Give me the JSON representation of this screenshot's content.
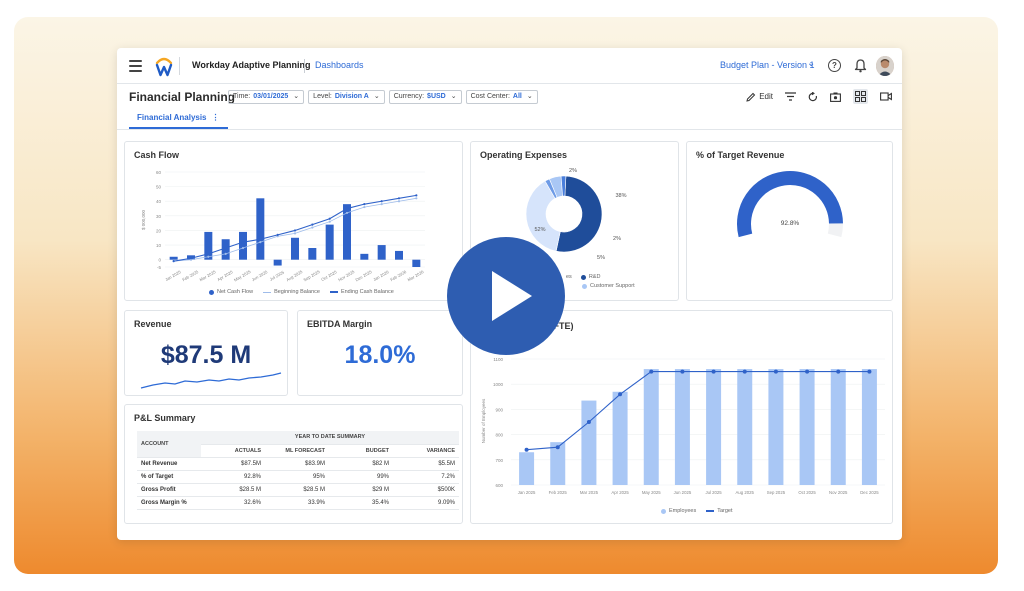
{
  "header": {
    "app_title": "Workday Adaptive Planning",
    "breadcrumb": "Dashboards",
    "plan_selector": "Budget Plan - Version 1",
    "help": "?"
  },
  "subheader": {
    "page_title": "Financial Planning",
    "filters": [
      {
        "label": "Time:",
        "value": "03/01/2025"
      },
      {
        "label": "Level:",
        "value": "Division A"
      },
      {
        "label": "Currency:",
        "value": "$USD"
      },
      {
        "label": "Cost Center:",
        "value": "All"
      }
    ],
    "edit_label": "Edit",
    "tab": "Financial Analysis"
  },
  "cards": {
    "cash_flow": {
      "title": "Cash Flow"
    },
    "operating_expenses": {
      "title": "Operating Expenses"
    },
    "target_revenue": {
      "title": "% of Target Revenue"
    },
    "revenue": {
      "title": "Revenue",
      "value": "$87.5 M"
    },
    "ebitda": {
      "title": "EBITDA Margin",
      "value": "18.0%"
    },
    "pl_summary": {
      "title": "P&L Summary"
    },
    "fte": {
      "title_fragment": "s (FTE)"
    }
  },
  "pl_table": {
    "account_header": "ACCOUNT",
    "group_header": "YEAR TO DATE SUMMARY",
    "columns": [
      "ACTUALS",
      "ML FORECAST",
      "BUDGET",
      "VARIANCE"
    ],
    "rows": [
      {
        "account": "Net Revenue",
        "values": [
          "$87.5M",
          "$83.9M",
          "$82 M",
          "$5.5M"
        ]
      },
      {
        "account": "% of Target",
        "values": [
          "92.8%",
          "95%",
          "99%",
          "7.2%"
        ]
      },
      {
        "account": "Gross Profit",
        "values": [
          "$28.5 M",
          "$28.5 M",
          "$29 M",
          "$500K"
        ]
      },
      {
        "account": "Gross Margin %",
        "values": [
          "32.6%",
          "33.9%",
          "35.4%",
          "9.09%"
        ]
      }
    ]
  },
  "colors": {
    "accent": "#2e6bd6",
    "bar_dark": "#2f62c9",
    "bar_light": "#a9c7f5",
    "play": "#2e5db1"
  },
  "chart_data": [
    {
      "type": "bar",
      "title": "Cash Flow",
      "ylabel": "$ 000,000",
      "categories": [
        "Jan 2025",
        "Feb 2025",
        "Mar 2025",
        "Apr 2025",
        "May 2025",
        "Jun 2025",
        "Jul 2025",
        "Aug 2025",
        "Sep 2025",
        "Oct 2025",
        "Nov 2025",
        "Dec 2025",
        "Jan 2026",
        "Feb 2026",
        "Mar 2026"
      ],
      "ylim": [
        -5,
        60
      ],
      "yticks": [
        -5,
        0,
        10,
        20,
        30,
        40,
        50,
        60
      ],
      "series": [
        {
          "name": "Net Cash Flow",
          "type": "bar",
          "values": [
            2,
            3,
            19,
            14,
            19,
            42,
            -4,
            15,
            8,
            24,
            38,
            4,
            10,
            6,
            -5
          ]
        },
        {
          "name": "Beginning Balance",
          "type": "line",
          "values": [
            -1,
            0,
            2,
            4,
            8,
            12,
            16,
            18,
            22,
            26,
            32,
            36,
            38,
            40,
            42
          ]
        },
        {
          "name": "Ending Cash Balance",
          "type": "line",
          "values": [
            -1,
            1,
            4,
            8,
            12,
            14,
            17,
            20,
            24,
            28,
            35,
            38,
            40,
            42,
            44
          ]
        }
      ]
    },
    {
      "type": "pie",
      "title": "Operating Expenses",
      "series": [
        {
          "name": "Operating Expenses",
          "values": [
            52,
            38,
            2,
            5,
            2
          ]
        }
      ],
      "slice_labels": [
        "52%",
        "38%",
        "2%",
        "5%",
        "2%"
      ],
      "legend_visible": [
        "R&D",
        "Customer Support"
      ],
      "legend_fragment": "es"
    },
    {
      "type": "gauge",
      "title": "% of Target Revenue",
      "value": 92.8,
      "label": "92.8%"
    },
    {
      "type": "bar",
      "title": "s (FTE)",
      "ylabel": "Number of Employees",
      "categories": [
        "Jan 2025",
        "Feb 2025",
        "Mar 2025",
        "Apr 2025",
        "May 2025",
        "Jun 2025",
        "Jul 2025",
        "Aug 2025",
        "Sep 2025",
        "Oct 2025",
        "Nov 2025",
        "Dec 2025"
      ],
      "ylim": [
        600,
        1100
      ],
      "yticks": [
        600,
        700,
        800,
        900,
        1000,
        1100
      ],
      "series": [
        {
          "name": "Employees",
          "type": "bar",
          "values": [
            730,
            770,
            935,
            970,
            1060,
            1060,
            1060,
            1060,
            1060,
            1060,
            1060,
            1060
          ]
        },
        {
          "name": "Target",
          "type": "line",
          "values": [
            740,
            750,
            850,
            960,
            1050,
            1050,
            1050,
            1050,
            1050,
            1050,
            1050,
            1050
          ]
        }
      ]
    }
  ]
}
